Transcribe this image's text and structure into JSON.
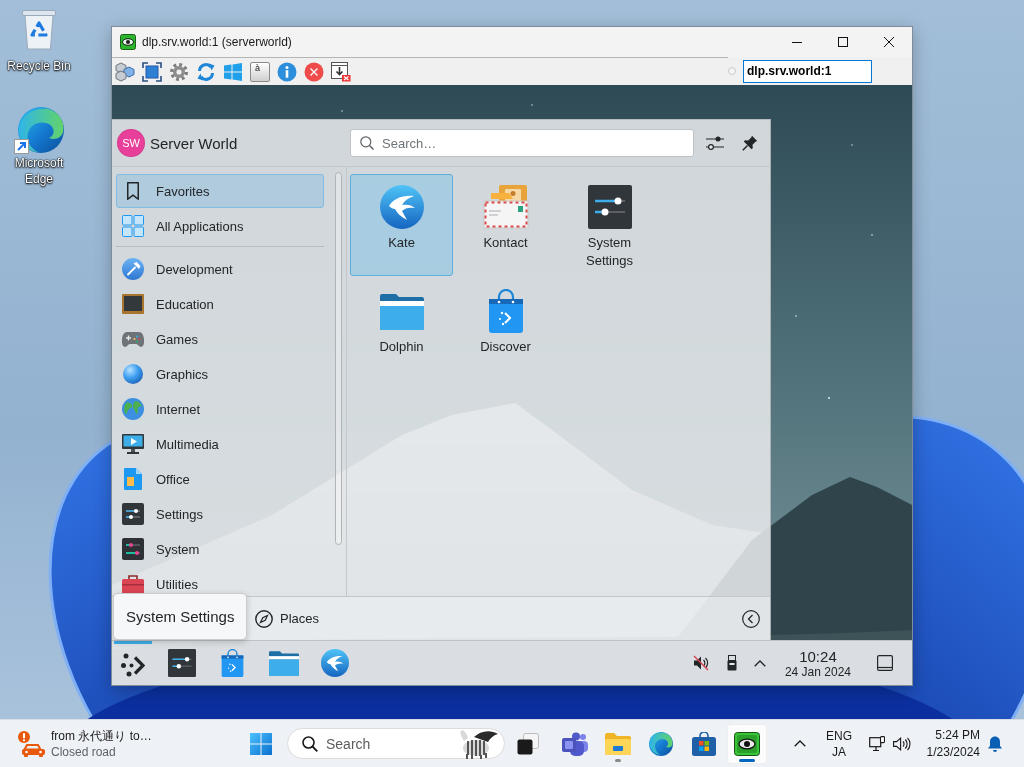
{
  "desktop": {
    "icons": [
      {
        "label": "Recycle Bin"
      },
      {
        "label": "Microsoft Edge"
      }
    ]
  },
  "viewer": {
    "title": "dlp.srv.world:1 (serverworld)",
    "key_label": "à",
    "address": "dlp.srv.world:1"
  },
  "launcher": {
    "user": {
      "initials": "SW",
      "name": "Server World"
    },
    "search": {
      "placeholder": "Search…"
    },
    "views": [
      {
        "label": "Favorites",
        "selected": true
      },
      {
        "label": "All Applications",
        "selected": false
      }
    ],
    "categories": [
      {
        "label": "Development",
        "selected": false
      },
      {
        "label": "Education",
        "selected": false
      },
      {
        "label": "Games",
        "selected": false
      },
      {
        "label": "Graphics",
        "selected": false
      },
      {
        "label": "Internet",
        "selected": false
      },
      {
        "label": "Multimedia",
        "selected": false
      },
      {
        "label": "Office",
        "selected": false
      },
      {
        "label": "Settings",
        "selected": false
      },
      {
        "label": "System",
        "selected": false
      },
      {
        "label": "Utilities",
        "selected": false
      }
    ],
    "apps": [
      {
        "label": "Kate",
        "selected": true
      },
      {
        "label": "Kontact",
        "selected": false
      },
      {
        "label": "System Settings",
        "selected": false
      },
      {
        "label": "Dolphin",
        "selected": false
      },
      {
        "label": "Discover",
        "selected": false
      }
    ],
    "tabs": [
      {
        "label": "Places",
        "selected": false
      }
    ]
  },
  "panel": {
    "launcher_active": true,
    "tooltip": "System Settings",
    "clock": {
      "time": "10:24",
      "date": "24 Jan 2024"
    }
  },
  "taskbar": {
    "widget": {
      "title": "from 永代通り to…",
      "subtitle": "Closed road"
    },
    "search": {
      "placeholder": "Search"
    },
    "apps": [
      {
        "running": false,
        "selected": false
      },
      {
        "running": true,
        "selected": false
      },
      {
        "running": false,
        "selected": false
      },
      {
        "running": false,
        "selected": false
      },
      {
        "running": true,
        "selected": true
      }
    ],
    "tray": {
      "language": "ENG",
      "input_mode": "JA"
    },
    "clock": {
      "time": "5:24 PM",
      "date": "1/23/2024"
    }
  }
}
